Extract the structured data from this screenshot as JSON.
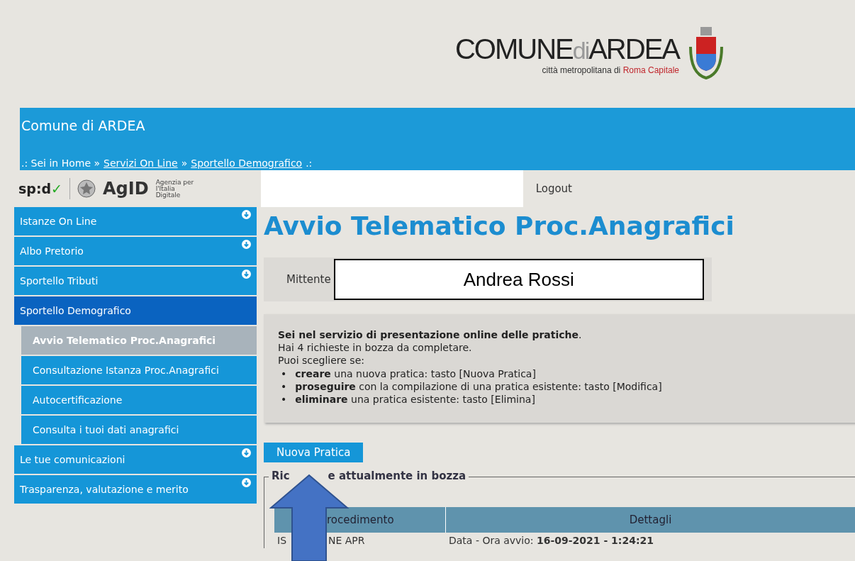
{
  "logo": {
    "name_main": "COMUNE",
    "name_di": "di",
    "name_city": "ARDEA",
    "subtitle_plain": "città metropolitana di",
    "subtitle_highlight": "Roma Capitale"
  },
  "header": {
    "title": "Comune di ARDEA",
    "breadcrumb": [
      {
        "label": ".: Sei in Home »",
        "kind": "text"
      },
      {
        "label": "Servizi On Line",
        "kind": "link"
      },
      {
        "label": "»",
        "kind": "text"
      },
      {
        "label": "Sportello Demografico",
        "kind": "link"
      },
      {
        "label": ".:",
        "kind": "text"
      }
    ]
  },
  "auth_bar": {
    "spid": "sp:d",
    "spid_check": "✓",
    "agid": "AgID",
    "agid_caption": "Agenzia per l'Italia Digitale",
    "logout": "Logout"
  },
  "sidebar": {
    "items": [
      {
        "label": "Istanze On Line",
        "selected": false,
        "expandable": true
      },
      {
        "label": "Albo Pretorio",
        "selected": false,
        "expandable": true
      },
      {
        "label": "Sportello Tributi",
        "selected": false,
        "expandable": true
      },
      {
        "label": "Sportello Demografico",
        "selected": true,
        "expandable": false,
        "children": [
          {
            "label": "Avvio Telematico Proc.Anagrafici",
            "selected": true
          },
          {
            "label": "Consultazione Istanza Proc.Anagrafici",
            "selected": false
          },
          {
            "label": "Autocertificazione",
            "selected": false
          },
          {
            "label": "Consulta i tuoi dati anagrafici",
            "selected": false
          }
        ]
      },
      {
        "label": "Le tue comunicazioni",
        "selected": false,
        "expandable": true
      },
      {
        "label": "Trasparenza, valutazione e merito",
        "selected": false,
        "expandable": true
      }
    ]
  },
  "page_title": "Avvio Telematico Proc.Anagrafici",
  "sender": {
    "label": "Mittente",
    "name": "Andrea Rossi"
  },
  "info": {
    "lines": [
      "**Sei nel servizio di presentazione online delle pratiche**.",
      "Hai 4 richieste in bozza da completare.",
      "Puoi scegliere se:"
    ],
    "bullets": [
      {
        "marker": "•",
        "text": "**creare** una nuova pratica: tasto [Nuova Pratica]"
      },
      {
        "marker": "•",
        "text": "**proseguire** con la compilazione di una pratica esistente: tasto [Modifica]"
      },
      {
        "marker": "•",
        "text": "**eliminare** una pratica esistente: tasto [Elimina]"
      }
    ]
  },
  "new_button": "Nuova Pratica",
  "drafts": {
    "legend_start": "Ric",
    "legend_end": "e attualmente in bozza",
    "columns": [
      "",
      "rocedimento",
      "Dettagli"
    ],
    "rows": [
      {
        "cells": [
          "IS",
          "NE APR"
        ],
        "details_label": "Data - Ora avvio:",
        "details_value": "16-09-2021 - 1:24:21"
      }
    ]
  }
}
